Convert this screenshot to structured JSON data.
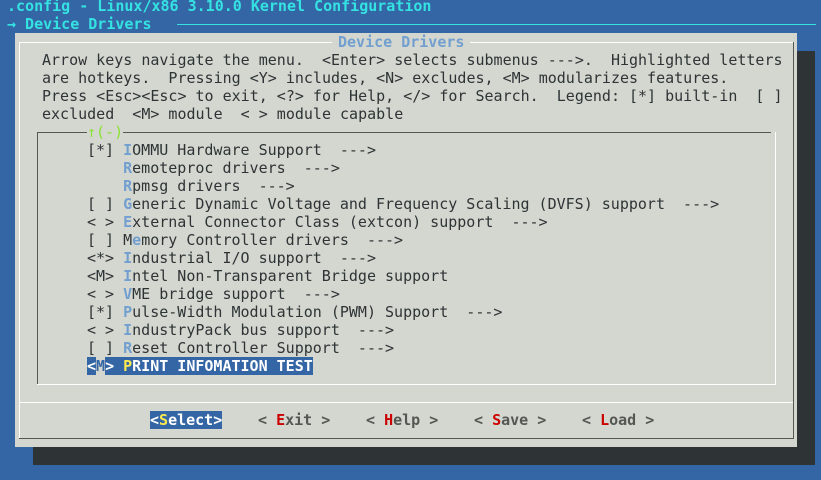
{
  "header": {
    "title": ".config - Linux/x86 3.10.0 Kernel Configuration",
    "breadcrumb": "→ Device Drivers"
  },
  "dialog": {
    "title": "Device Drivers",
    "help_lines": [
      "Arrow keys navigate the menu.  <Enter> selects submenus --->.  Highlighted letters",
      "are hotkeys.  Pressing <Y> includes, <N> excludes, <M> modularizes features.",
      "Press <Esc><Esc> to exit, <?> for Help, </> for Search.  Legend: [*] built-in  [ ]",
      "excluded  <M> module  < > module capable"
    ],
    "scroll_marker": "↑(-)",
    "items": [
      {
        "prefix": "[*] ",
        "pre": "",
        "hotkey": "I",
        "post": "OMMU Hardware Support  --->"
      },
      {
        "prefix": "    ",
        "pre": "",
        "hotkey": "R",
        "post": "emoteproc drivers  --->"
      },
      {
        "prefix": "    ",
        "pre": "",
        "hotkey": "R",
        "post": "pmsg drivers  --->"
      },
      {
        "prefix": "[ ] ",
        "pre": "",
        "hotkey": "G",
        "post": "eneric Dynamic Voltage and Frequency Scaling (DVFS) support  --->"
      },
      {
        "prefix": "< > ",
        "pre": "",
        "hotkey": "E",
        "post": "xternal Connector Class (extcon) support  --->"
      },
      {
        "prefix": "[ ] ",
        "pre": "M",
        "hotkey": "e",
        "post": "mory Controller drivers  --->"
      },
      {
        "prefix": "<*> ",
        "pre": "",
        "hotkey": "I",
        "post": "ndustrial I/O support  --->"
      },
      {
        "prefix": "<M> ",
        "pre": "",
        "hotkey": "I",
        "post": "ntel Non-Transparent Bridge support"
      },
      {
        "prefix": "< > ",
        "pre": "",
        "hotkey": "V",
        "post": "ME bridge support  --->"
      },
      {
        "prefix": "[*] ",
        "pre": "",
        "hotkey": "P",
        "post": "ulse-Width Modulation (PWM) Support  --->"
      },
      {
        "prefix": "< > ",
        "pre": "",
        "hotkey": "I",
        "post": "ndustryPack bus support  --->"
      },
      {
        "prefix": "[ ] ",
        "pre": "",
        "hotkey": "R",
        "post": "eset Controller Support  --->"
      }
    ],
    "selected_item": {
      "prefix_open": "<",
      "prefix_state": "M",
      "prefix_close": "> ",
      "hotkey": "P",
      "post": "RINT INFOMATION TEST"
    },
    "buttons": [
      {
        "open": "<",
        "key": "S",
        "rest": "elect",
        "close": ">"
      },
      {
        "open": "< ",
        "key": "E",
        "rest": "xit",
        "close": " >"
      },
      {
        "open": "< ",
        "key": "H",
        "rest": "elp",
        "close": " >"
      },
      {
        "open": "< ",
        "key": "S",
        "rest": "ave",
        "close": " >"
      },
      {
        "open": "< ",
        "key": "L",
        "rest": "oad",
        "close": " >"
      }
    ]
  }
}
